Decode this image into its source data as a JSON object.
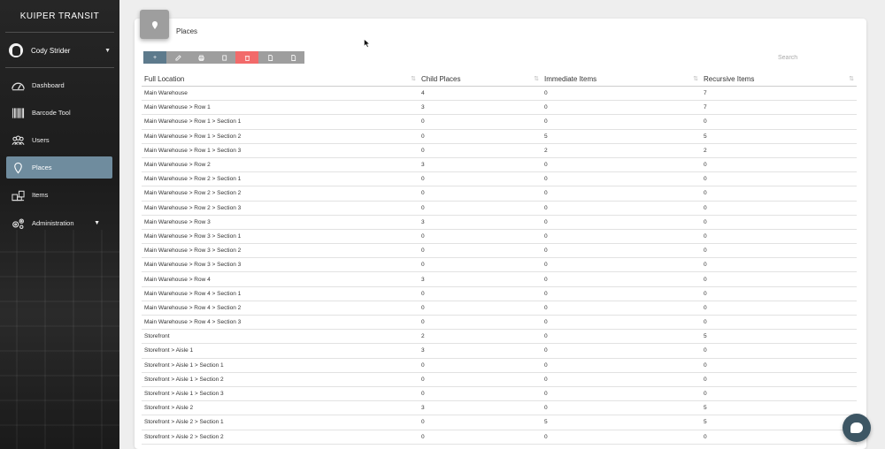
{
  "sidebar": {
    "brand": "KUIPER TRANSIT",
    "user": {
      "name": "Cody Strider"
    },
    "items": [
      {
        "label": "Dashboard",
        "icon": "dashboard-icon"
      },
      {
        "label": "Barcode Tool",
        "icon": "barcode-icon"
      },
      {
        "label": "Users",
        "icon": "users-icon"
      },
      {
        "label": "Places",
        "icon": "map-pin-icon",
        "active": true
      },
      {
        "label": "Items",
        "icon": "items-icon"
      },
      {
        "label": "Administration",
        "icon": "gears-icon"
      }
    ]
  },
  "page": {
    "title": "Places",
    "icon": "map-pin-icon"
  },
  "toolbar": {
    "buttons": [
      {
        "label": "+",
        "icon": "add-icon"
      },
      {
        "label": "",
        "icon": "edit-icon"
      },
      {
        "label": "",
        "icon": "print-icon"
      },
      {
        "label": "",
        "icon": "copy-icon"
      },
      {
        "label": "",
        "icon": "delete-icon"
      },
      {
        "label": "",
        "icon": "file-icon"
      },
      {
        "label": "",
        "icon": "file-icon"
      }
    ]
  },
  "search": {
    "placeholder": "Search"
  },
  "table": {
    "columns": [
      "Full Location",
      "Child Places",
      "Immediate Items",
      "Recursive Items"
    ],
    "rows": [
      [
        "Main Warehouse",
        "4",
        "0",
        "7"
      ],
      [
        "Main Warehouse > Row 1",
        "3",
        "0",
        "7"
      ],
      [
        "Main Warehouse > Row 1 > Section 1",
        "0",
        "0",
        "0"
      ],
      [
        "Main Warehouse > Row 1 > Section 2",
        "0",
        "5",
        "5"
      ],
      [
        "Main Warehouse > Row 1 > Section 3",
        "0",
        "2",
        "2"
      ],
      [
        "Main Warehouse > Row 2",
        "3",
        "0",
        "0"
      ],
      [
        "Main Warehouse > Row 2 > Section 1",
        "0",
        "0",
        "0"
      ],
      [
        "Main Warehouse > Row 2 > Section 2",
        "0",
        "0",
        "0"
      ],
      [
        "Main Warehouse > Row 2 > Section 3",
        "0",
        "0",
        "0"
      ],
      [
        "Main Warehouse > Row 3",
        "3",
        "0",
        "0"
      ],
      [
        "Main Warehouse > Row 3 > Section 1",
        "0",
        "0",
        "0"
      ],
      [
        "Main Warehouse > Row 3 > Section 2",
        "0",
        "0",
        "0"
      ],
      [
        "Main Warehouse > Row 3 > Section 3",
        "0",
        "0",
        "0"
      ],
      [
        "Main Warehouse > Row 4",
        "3",
        "0",
        "0"
      ],
      [
        "Main Warehouse > Row 4 > Section 1",
        "0",
        "0",
        "0"
      ],
      [
        "Main Warehouse > Row 4 > Section 2",
        "0",
        "0",
        "0"
      ],
      [
        "Main Warehouse > Row 4 > Section 3",
        "0",
        "0",
        "0"
      ],
      [
        "Storefront",
        "2",
        "0",
        "5"
      ],
      [
        "Storefront > Aisle 1",
        "3",
        "0",
        "0"
      ],
      [
        "Storefront > Aisle 1 > Section 1",
        "0",
        "0",
        "0"
      ],
      [
        "Storefront > Aisle 1 > Section 2",
        "0",
        "0",
        "0"
      ],
      [
        "Storefront > Aisle 1 > Section 3",
        "0",
        "0",
        "0"
      ],
      [
        "Storefront > Aisle 2",
        "3",
        "0",
        "5"
      ],
      [
        "Storefront > Aisle 2 > Section 1",
        "0",
        "5",
        "5"
      ],
      [
        "Storefront > Aisle 2 > Section 2",
        "0",
        "0",
        "0"
      ]
    ]
  },
  "colors": {
    "accent": "#5d7a8c",
    "active_nav": "#6f8c9e",
    "danger": "#f26a6a",
    "chat": "#3d5664"
  }
}
